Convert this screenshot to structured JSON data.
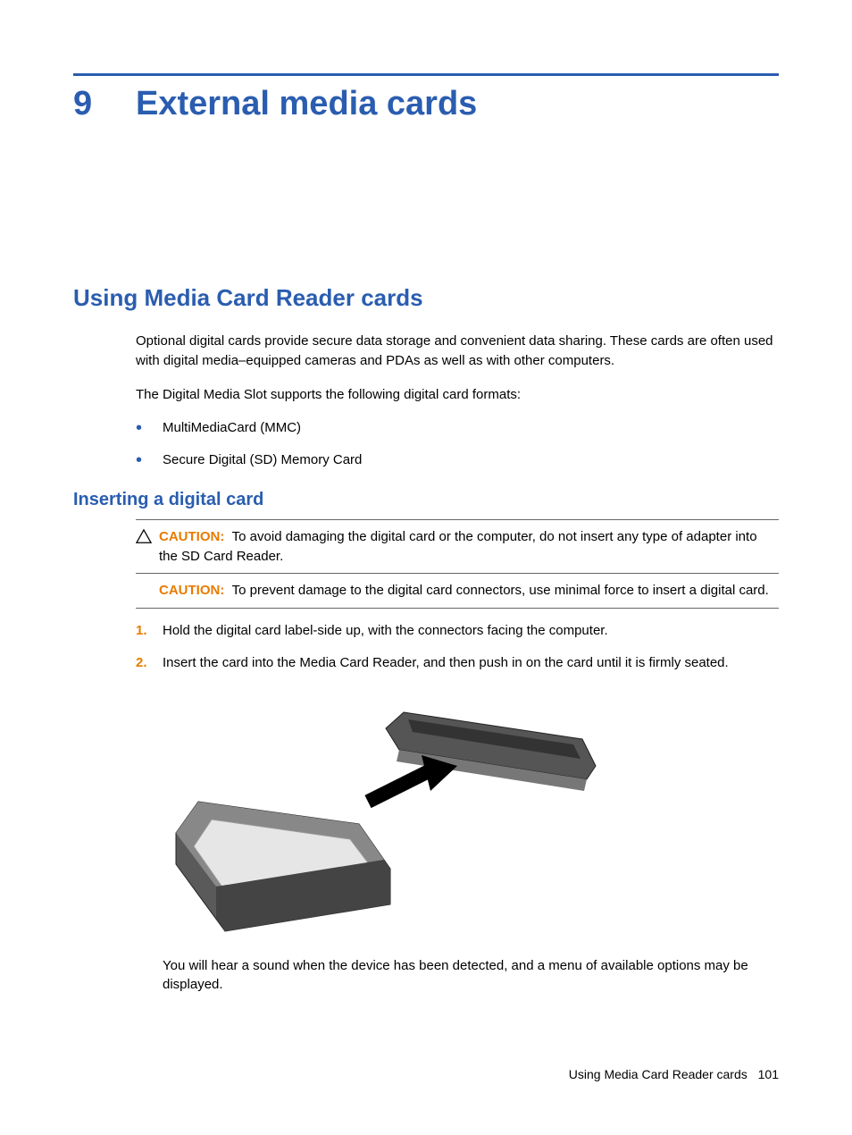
{
  "chapter": {
    "number": "9",
    "title": "External media cards"
  },
  "section": {
    "h2": "Using Media Card Reader cards",
    "intro": "Optional digital cards provide secure data storage and convenient data sharing. These cards are often used with digital media–equipped cameras and PDAs as well as with other computers.",
    "formats_line": "The Digital Media Slot supports the following digital card formats:",
    "formats": [
      "MultiMediaCard (MMC)",
      "Secure Digital (SD) Memory Card"
    ],
    "h3": "Inserting a digital card",
    "caution1": {
      "label": "CAUTION:",
      "text": "To avoid damaging the digital card or the computer, do not insert any type of adapter into the SD Card Reader."
    },
    "caution2": {
      "label": "CAUTION:",
      "text": "To prevent damage to the digital card connectors, use minimal force to insert a digital card."
    },
    "steps": [
      "Hold the digital card label-side up, with the connectors facing the computer.",
      "Insert the card into the Media Card Reader, and then push in on the card until it is firmly seated."
    ],
    "post": "You will hear a sound when the device has been detected, and a menu of available options may be displayed."
  },
  "footer": {
    "section": "Using Media Card Reader cards",
    "page": "101"
  }
}
